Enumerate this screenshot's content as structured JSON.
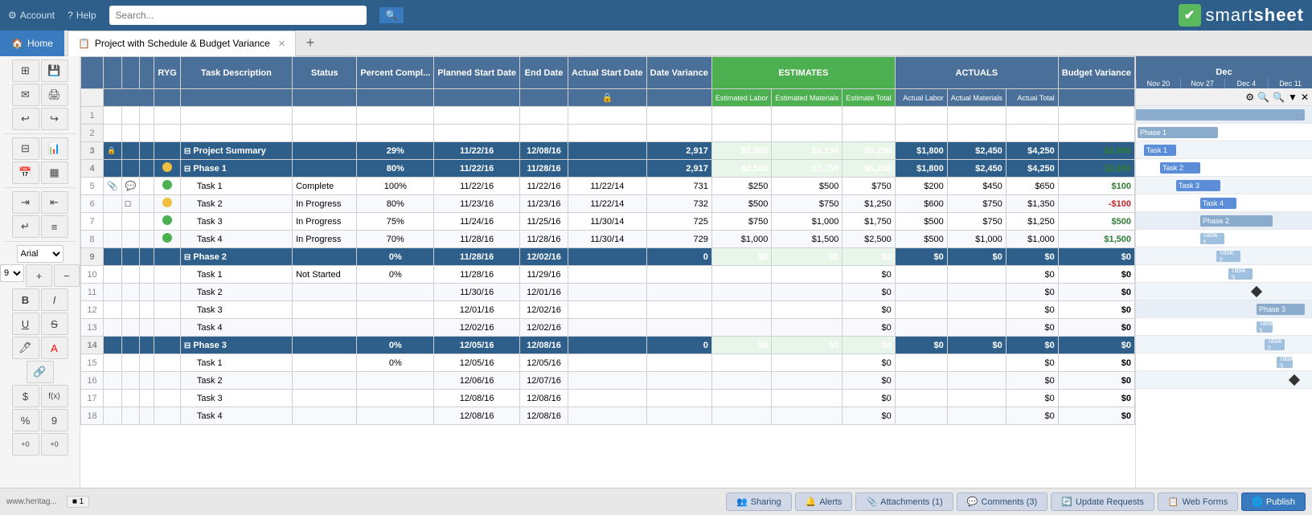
{
  "app": {
    "title": "smartsheet",
    "logo_check": "✔"
  },
  "topnav": {
    "account_label": "Account",
    "help_label": "Help",
    "search_placeholder": "Search...",
    "search_btn_label": "🔍"
  },
  "tabs": {
    "home_label": "Home",
    "sheet_label": "Project with Schedule & Budget Variance",
    "add_tab_label": "+"
  },
  "toolbar": {
    "font": "Arial",
    "font_size": "9",
    "bold": "B",
    "italic": "I",
    "underline": "U",
    "strikethrough": "S"
  },
  "columns": {
    "ryg": "RYG",
    "task_desc": "Task Description",
    "status": "Status",
    "pct_complete": "Percent Compl...",
    "planned_start": "Planned Start Date",
    "end_date": "End Date",
    "actual_start": "Actual Start Date",
    "date_variance": "Date Variance",
    "est_labor": "Estimated Labor",
    "est_materials": "Estimated Materials",
    "est_total": "Estimate Total",
    "act_labor": "Actual Labor",
    "act_materials": "Actual Materials",
    "act_total": "Actual Total",
    "budget_variance": "Budget Variance",
    "estimates_label": "ESTIMATES",
    "actuals_label": "ACTUALS",
    "gantt_month": "Dec",
    "gantt_dates": [
      "Nov 20",
      "Nov 27",
      "Dec 4",
      "Dec 11"
    ]
  },
  "rows": [
    {
      "row": 1,
      "type": "header_spacer"
    },
    {
      "row": 2,
      "type": "spacer"
    },
    {
      "row": 3,
      "type": "summary",
      "ryg": "",
      "task": "Project Summary",
      "status": "",
      "pct": "29%",
      "p_start": "11/22/16",
      "end": "12/08/16",
      "a_start": "",
      "d_var": "2,917",
      "e_labor": "$2,500",
      "e_mat": "$3,750",
      "e_tot": "$6,250",
      "a_labor": "$1,800",
      "a_mat": "$2,450",
      "a_tot": "$4,250",
      "b_var": "$2,000"
    },
    {
      "row": 4,
      "type": "phase",
      "ryg": "yellow",
      "task": "Phase 1",
      "status": "",
      "pct": "80%",
      "p_start": "11/22/16",
      "end": "11/28/16",
      "a_start": "",
      "d_var": "2,917",
      "e_labor": "$2,500",
      "e_mat": "$3,750",
      "e_tot": "$6,250",
      "a_labor": "$1,800",
      "a_mat": "$2,450",
      "a_tot": "$4,250",
      "b_var": "$2,000"
    },
    {
      "row": 5,
      "type": "task",
      "ryg": "green",
      "task": "Task 1",
      "status": "Complete",
      "pct": "100%",
      "p_start": "11/22/16",
      "end": "11/22/16",
      "a_start": "11/22/14",
      "d_var": "731",
      "e_labor": "$250",
      "e_mat": "$500",
      "e_tot": "$750",
      "a_labor": "$200",
      "a_mat": "$450",
      "a_tot": "$650",
      "b_var": "$100"
    },
    {
      "row": 6,
      "type": "task_alt",
      "ryg": "yellow",
      "task": "Task 2",
      "status": "In Progress",
      "pct": "80%",
      "p_start": "11/23/16",
      "end": "11/23/16",
      "a_start": "11/22/14",
      "d_var": "732",
      "e_labor": "$500",
      "e_mat": "$750",
      "e_tot": "$1,250",
      "a_labor": "$600",
      "a_mat": "$750",
      "a_tot": "$1,350",
      "b_var": "-$100"
    },
    {
      "row": 7,
      "type": "task",
      "ryg": "green",
      "task": "Task 3",
      "status": "In Progress",
      "pct": "75%",
      "p_start": "11/24/16",
      "end": "11/25/16",
      "a_start": "11/30/14",
      "d_var": "725",
      "e_labor": "$750",
      "e_mat": "$1,000",
      "e_tot": "$1,750",
      "a_labor": "$500",
      "a_mat": "$750",
      "a_tot": "$1,250",
      "b_var": "$500"
    },
    {
      "row": 8,
      "type": "task_alt",
      "ryg": "green",
      "task": "Task 4",
      "status": "In Progress",
      "pct": "70%",
      "p_start": "11/28/16",
      "end": "11/28/16",
      "a_start": "11/30/14",
      "d_var": "729",
      "e_labor": "$1,000",
      "e_mat": "$1,500",
      "e_tot": "$2,500",
      "a_labor": "$500",
      "a_mat": "$1,000",
      "a_tot": "$1,000",
      "b_var": "$1,500"
    },
    {
      "row": 9,
      "type": "phase",
      "ryg": "",
      "task": "Phase 2",
      "status": "",
      "pct": "0%",
      "p_start": "11/28/16",
      "end": "12/02/16",
      "a_start": "",
      "d_var": "0",
      "e_labor": "$0",
      "e_mat": "$0",
      "e_tot": "$0",
      "a_labor": "$0",
      "a_mat": "$0",
      "a_tot": "$0",
      "b_var": "$0"
    },
    {
      "row": 10,
      "type": "task",
      "ryg": "",
      "task": "Task 1",
      "status": "Not Started",
      "pct": "0%",
      "p_start": "11/28/16",
      "end": "11/29/16",
      "a_start": "",
      "d_var": "",
      "e_labor": "",
      "e_mat": "",
      "e_tot": "$0",
      "a_labor": "",
      "a_mat": "",
      "a_tot": "$0",
      "b_var": "$0"
    },
    {
      "row": 11,
      "type": "task_alt",
      "ryg": "",
      "task": "Task 2",
      "status": "",
      "pct": "",
      "p_start": "11/30/16",
      "end": "12/01/16",
      "a_start": "",
      "d_var": "",
      "e_labor": "",
      "e_mat": "",
      "e_tot": "$0",
      "a_labor": "",
      "a_mat": "",
      "a_tot": "$0",
      "b_var": "$0"
    },
    {
      "row": 12,
      "type": "task",
      "ryg": "",
      "task": "Task 3",
      "status": "",
      "pct": "",
      "p_start": "12/01/16",
      "end": "12/02/16",
      "a_start": "",
      "d_var": "",
      "e_labor": "",
      "e_mat": "",
      "e_tot": "$0",
      "a_labor": "",
      "a_mat": "",
      "a_tot": "$0",
      "b_var": "$0"
    },
    {
      "row": 13,
      "type": "task_alt",
      "ryg": "",
      "task": "Task 4",
      "status": "",
      "pct": "",
      "p_start": "12/02/16",
      "end": "12/02/16",
      "a_start": "",
      "d_var": "",
      "e_labor": "",
      "e_mat": "",
      "e_tot": "$0",
      "a_labor": "",
      "a_mat": "",
      "a_tot": "$0",
      "b_var": "$0"
    },
    {
      "row": 14,
      "type": "phase",
      "ryg": "",
      "task": "Phase 3",
      "status": "",
      "pct": "0%",
      "p_start": "12/05/16",
      "end": "12/08/16",
      "a_start": "",
      "d_var": "0",
      "e_labor": "$0",
      "e_mat": "$0",
      "e_tot": "$0",
      "a_labor": "$0",
      "a_mat": "$0",
      "a_tot": "$0",
      "b_var": "$0"
    },
    {
      "row": 15,
      "type": "task",
      "ryg": "",
      "task": "Task 1",
      "status": "",
      "pct": "0%",
      "p_start": "12/05/16",
      "end": "12/05/16",
      "a_start": "",
      "d_var": "",
      "e_labor": "",
      "e_mat": "",
      "e_tot": "$0",
      "a_labor": "",
      "a_mat": "",
      "a_tot": "$0",
      "b_var": "$0"
    },
    {
      "row": 16,
      "type": "task_alt",
      "ryg": "",
      "task": "Task 2",
      "status": "",
      "pct": "",
      "p_start": "12/06/16",
      "end": "12/07/16",
      "a_start": "",
      "d_var": "",
      "e_labor": "",
      "e_mat": "",
      "e_tot": "$0",
      "a_labor": "",
      "a_mat": "",
      "a_tot": "$0",
      "b_var": "$0"
    },
    {
      "row": 17,
      "type": "task",
      "ryg": "",
      "task": "Task 3",
      "status": "",
      "pct": "",
      "p_start": "12/08/16",
      "end": "12/08/16",
      "a_start": "",
      "d_var": "",
      "e_labor": "",
      "e_mat": "",
      "e_tot": "$0",
      "a_labor": "",
      "a_mat": "",
      "a_tot": "$0",
      "b_var": "$0"
    },
    {
      "row": 18,
      "type": "task_alt",
      "ryg": "",
      "task": "Task 4",
      "status": "",
      "pct": "",
      "p_start": "12/08/16",
      "end": "12/08/16",
      "a_start": "",
      "d_var": "",
      "e_labor": "",
      "e_mat": "",
      "e_tot": "$0",
      "a_labor": "",
      "a_mat": "",
      "a_tot": "$0",
      "b_var": "$0"
    }
  ],
  "bottombar": {
    "sharing_label": "Sharing",
    "alerts_label": "Alerts",
    "attachments_label": "Attachments (1)",
    "comments_label": "Comments (3)",
    "update_requests_label": "Update Requests",
    "web_forms_label": "Web Forms",
    "publish_label": "Publish"
  }
}
